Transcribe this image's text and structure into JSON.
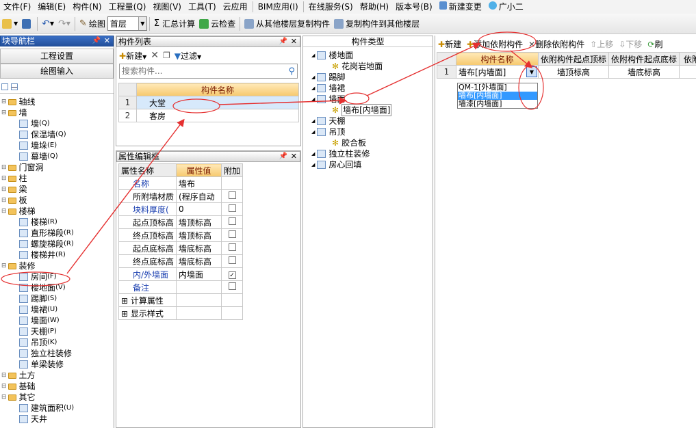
{
  "menubar": {
    "items": [
      "文件(F)",
      "编辑(E)",
      "构件(N)",
      "工程量(Q)",
      "视图(V)",
      "工具(T)",
      "云应用",
      "BIM应用(I)",
      "在线服务(S)",
      "帮助(H)",
      "版本号(B)",
      "新建变更",
      "广小二"
    ]
  },
  "toolbar": {
    "draw": "绘图",
    "floor": "首层",
    "sum": "汇总计算",
    "cloud_check": "云检查",
    "copy_from": "从其他楼层复制构件",
    "copy_to": "复制构件到其他楼层"
  },
  "left": {
    "title": "块导航栏",
    "btn1": "工程设置",
    "btn2": "绘图输入",
    "tree": [
      {
        "t": "轴线",
        "lvl": 0,
        "folder": true
      },
      {
        "t": "墙",
        "lvl": 0,
        "folder": true
      },
      {
        "t": "墙",
        "k": "(Q)",
        "lvl": 1
      },
      {
        "t": "保温墙",
        "k": "(Q)",
        "lvl": 1
      },
      {
        "t": "墙垛",
        "k": "(E)",
        "lvl": 1
      },
      {
        "t": "幕墙",
        "k": "(Q)",
        "lvl": 1
      },
      {
        "t": "门窗洞",
        "lvl": 0,
        "folder": true
      },
      {
        "t": "柱",
        "lvl": 0,
        "folder": true
      },
      {
        "t": "梁",
        "lvl": 0,
        "folder": true
      },
      {
        "t": "板",
        "lvl": 0,
        "folder": true
      },
      {
        "t": "楼梯",
        "lvl": 0,
        "folder": true
      },
      {
        "t": "楼梯",
        "k": "(R)",
        "lvl": 1
      },
      {
        "t": "直形梯段",
        "k": "(R)",
        "lvl": 1
      },
      {
        "t": "螺旋梯段",
        "k": "(R)",
        "lvl": 1
      },
      {
        "t": "楼梯井",
        "k": "(R)",
        "lvl": 1
      },
      {
        "t": "装修",
        "lvl": 0,
        "folder": true
      },
      {
        "t": "房间",
        "k": "(F)",
        "lvl": 1
      },
      {
        "t": "楼地面",
        "k": "(V)",
        "lvl": 1
      },
      {
        "t": "踢脚",
        "k": "(S)",
        "lvl": 1
      },
      {
        "t": "墙裙",
        "k": "(U)",
        "lvl": 1
      },
      {
        "t": "墙面",
        "k": "(W)",
        "lvl": 1
      },
      {
        "t": "天棚",
        "k": "(P)",
        "lvl": 1
      },
      {
        "t": "吊顶",
        "k": "(K)",
        "lvl": 1
      },
      {
        "t": "独立柱装修",
        "k": "",
        "lvl": 1
      },
      {
        "t": "单梁装修",
        "k": "",
        "lvl": 1
      },
      {
        "t": "土方",
        "lvl": 0,
        "folder": true
      },
      {
        "t": "基础",
        "lvl": 0,
        "folder": true
      },
      {
        "t": "其它",
        "lvl": 0,
        "folder": true
      },
      {
        "t": "建筑面积",
        "k": "(U)",
        "lvl": 1
      },
      {
        "t": "天井",
        "k": "",
        "lvl": 1
      }
    ]
  },
  "clist": {
    "title": "构件列表",
    "new": "新建",
    "filter": "过滤",
    "search_placeholder": "搜索构件...",
    "col": "构件名称",
    "rows": [
      {
        "n": "1",
        "name": "大堂"
      },
      {
        "n": "2",
        "name": "客房"
      }
    ]
  },
  "props": {
    "title": "属性编辑框",
    "cols": [
      "属性名称",
      "属性值",
      "附加"
    ],
    "rows": [
      {
        "name": "名称",
        "val": "墙布",
        "blue": true,
        "chk": ""
      },
      {
        "name": "所附墙材质",
        "val": "(程序自动",
        "chk": "no"
      },
      {
        "name": "块料厚度(",
        "val": "0",
        "blue": true,
        "chk": "no"
      },
      {
        "name": "起点顶标高",
        "val": "墙顶标高",
        "chk": "no"
      },
      {
        "name": "终点顶标高",
        "val": "墙顶标高",
        "chk": "no"
      },
      {
        "name": "起点底标高",
        "val": "墙底标高",
        "chk": "no"
      },
      {
        "name": "终点底标高",
        "val": "墙底标高",
        "chk": "no"
      },
      {
        "name": "内/外墙面",
        "val": "内墙面",
        "blue": true,
        "chk": "yes"
      },
      {
        "name": "备注",
        "val": "",
        "blue": true,
        "chk": "no"
      },
      {
        "name": "计算属性",
        "val": "",
        "expand": true,
        "chk": ""
      },
      {
        "name": "显示样式",
        "val": "",
        "expand": true,
        "chk": ""
      }
    ]
  },
  "types": {
    "title": "构件类型",
    "items": [
      {
        "t": "楼地面",
        "lvl": 0
      },
      {
        "t": "花岗岩地面",
        "lvl": 1
      },
      {
        "t": "踢脚",
        "lvl": 0
      },
      {
        "t": "墙裙",
        "lvl": 0
      },
      {
        "t": "墙面",
        "lvl": 0
      },
      {
        "t": "墙布[内墙面]",
        "lvl": 1
      },
      {
        "t": "天棚",
        "lvl": 0
      },
      {
        "t": "吊顶",
        "lvl": 0
      },
      {
        "t": "胶合板",
        "lvl": 1
      },
      {
        "t": "独立柱装修",
        "lvl": 0
      },
      {
        "t": "房心回填",
        "lvl": 0
      }
    ]
  },
  "right": {
    "new": "新建",
    "add_dep": "添加依附构件",
    "del_dep": "删除依附构件",
    "up": "上移",
    "down": "下移",
    "more": "刷",
    "cols": [
      "构件名称",
      "依附构件起点顶标",
      "依附构件起点底标",
      "依附"
    ],
    "row": {
      "n": "1",
      "name": "墙布[内墙面]",
      "c2": "墙顶标高",
      "c3": "墙底标高"
    },
    "dropdown": [
      "QM-1[外墙面]",
      "墙布[内墙面]",
      "墙漆[内墙面]"
    ]
  }
}
